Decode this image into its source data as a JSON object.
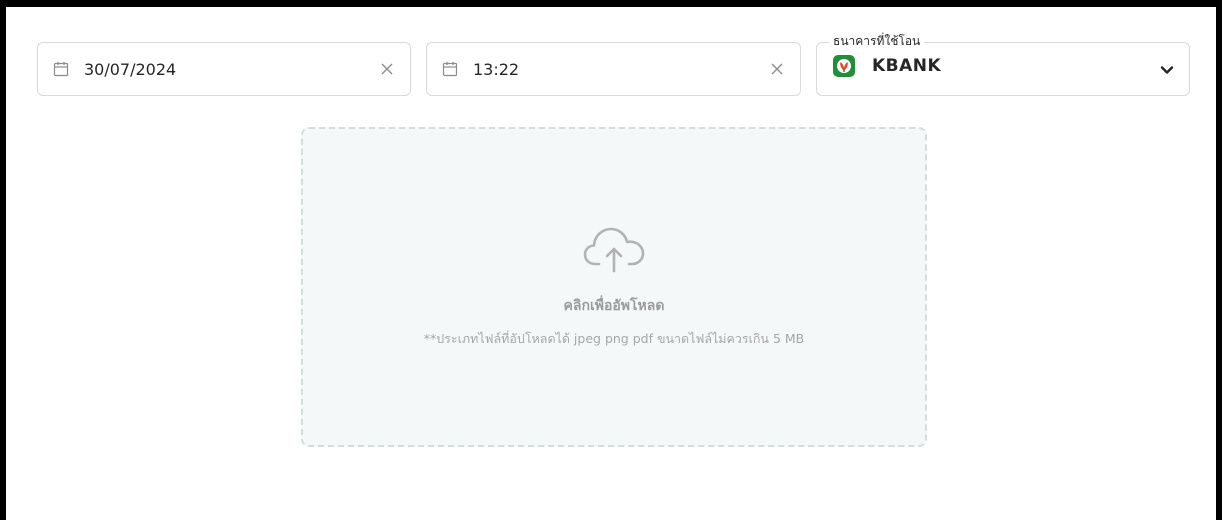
{
  "form": {
    "date": {
      "value": "30/07/2024",
      "icon": "calendar-icon",
      "clear_icon": "close-icon"
    },
    "time": {
      "value": "13:22",
      "icon": "calendar-icon",
      "clear_icon": "close-icon"
    },
    "bank": {
      "label": "ธนาคารที่ใช้โอน",
      "value": "KBANK",
      "logo_icon": "kbank-logo-icon",
      "dropdown_icon": "chevron-down-icon",
      "logo_color": "#1f8f3a"
    }
  },
  "upload": {
    "icon": "cloud-upload-icon",
    "title": "คลิกเพื่ออัพโหลด",
    "hint": "**ประเภทไฟล์ที่อัปโหลดได้ jpeg png pdf ขนาดไฟล์ไม่ควรเกิน 5 MB"
  },
  "colors": {
    "border": "#d9d9d9",
    "upload_background": "#f4f8f8",
    "upload_border": "#d4dcdc",
    "muted_text": "#9b9b9b"
  }
}
